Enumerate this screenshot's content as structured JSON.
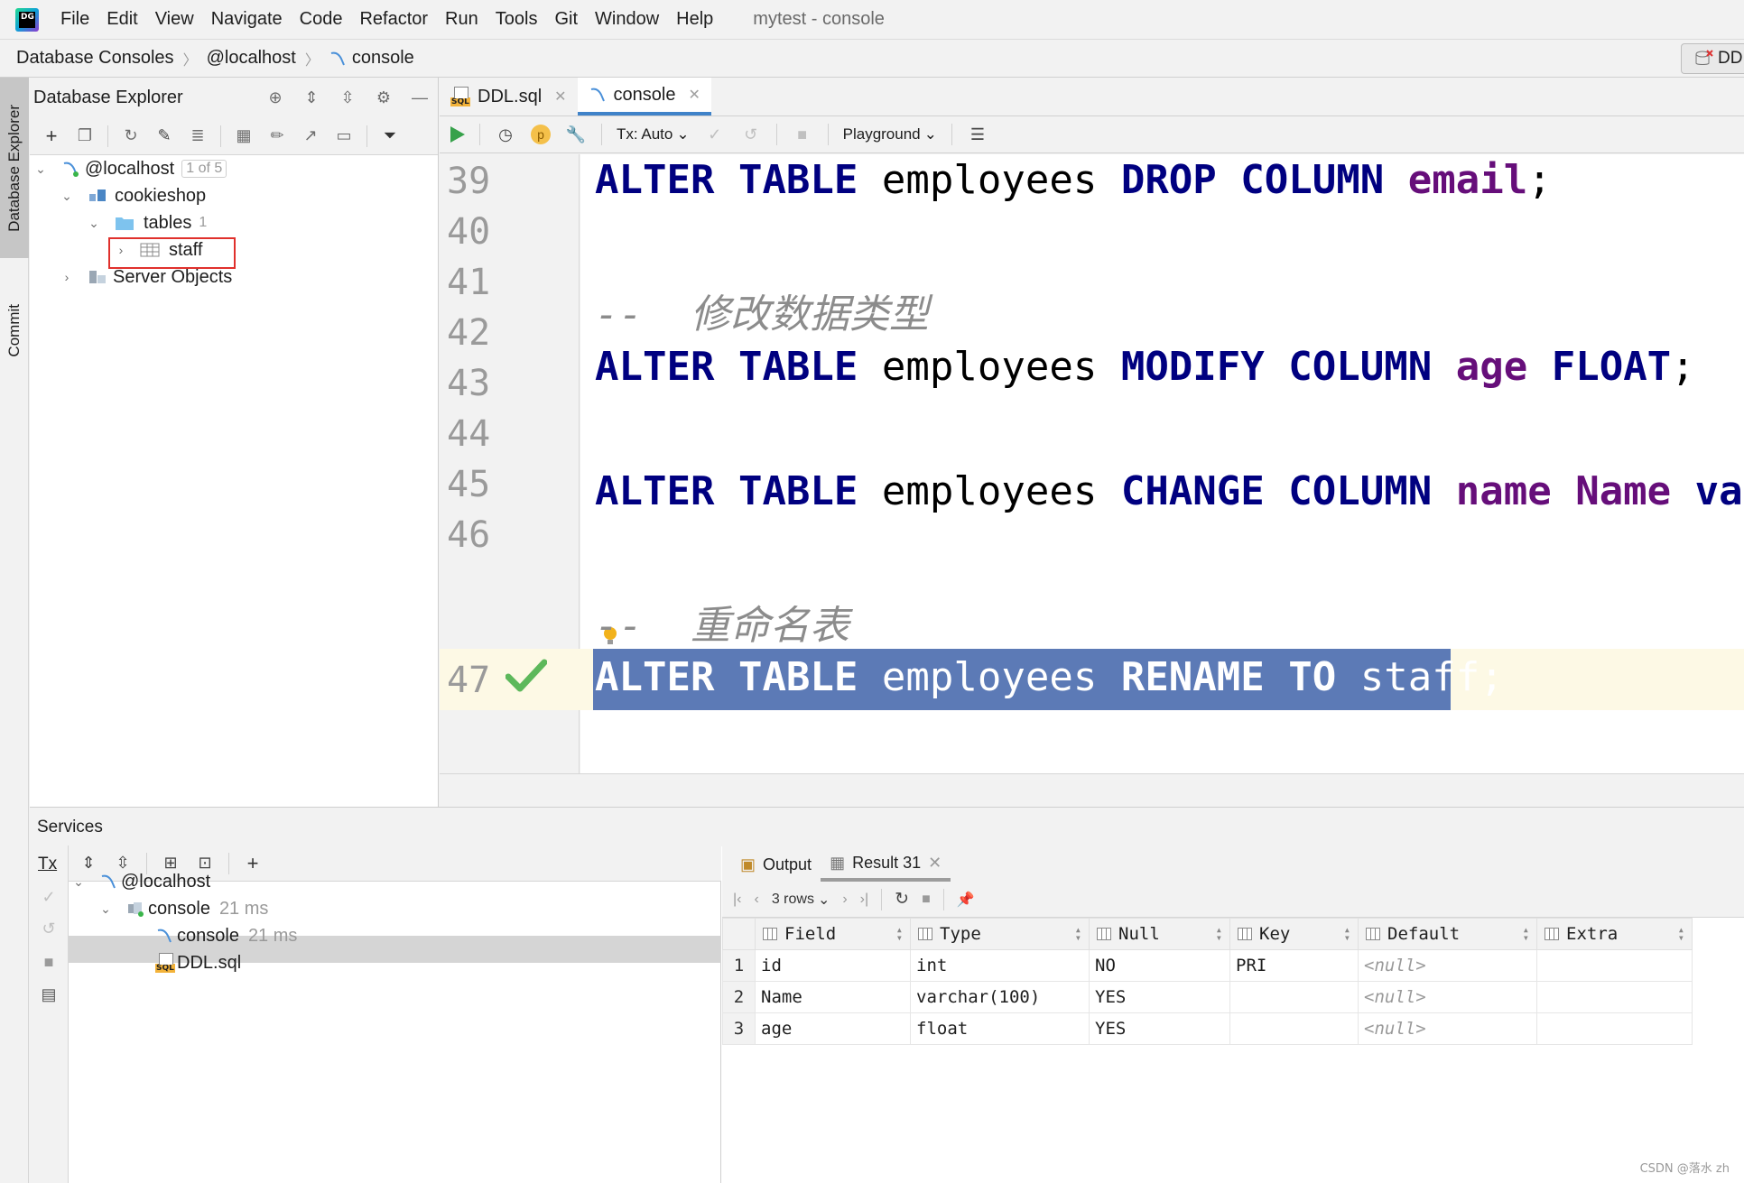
{
  "menubar": {
    "items": [
      {
        "label": "File"
      },
      {
        "label": "Edit"
      },
      {
        "label": "View"
      },
      {
        "label": "Navigate"
      },
      {
        "label": "Code"
      },
      {
        "label": "Refactor"
      },
      {
        "label": "Run"
      },
      {
        "label": "Tools"
      },
      {
        "label": "Git"
      },
      {
        "label": "Window"
      },
      {
        "label": "Help"
      }
    ],
    "window_title": "mytest - console"
  },
  "breadcrumbs": [
    "Database Consoles",
    "@localhost",
    "console"
  ],
  "dd_button": "DD",
  "left_strip": {
    "database_explorer": "Database Explorer",
    "commit": "Commit"
  },
  "db_explorer": {
    "title": "Database Explorer",
    "tree": {
      "host": "@localhost",
      "host_count": "1 of 5",
      "schema": "cookieshop",
      "tables_label": "tables",
      "tables_count": "1",
      "table": "staff",
      "server_objects": "Server Objects"
    }
  },
  "editor": {
    "tabs": [
      {
        "label": "DDL.sql"
      },
      {
        "label": "console"
      }
    ],
    "tx_mode": "Tx: Auto",
    "playground": "Playground",
    "line_numbers": [
      "39",
      "40",
      "41",
      "42",
      "43",
      "44",
      "45",
      "46",
      "47"
    ],
    "lines": {
      "l39": [
        "ALTER",
        "TABLE",
        "employees",
        "DROP",
        "COLUMN",
        "email",
        ";"
      ],
      "l41": "--  修改数据类型",
      "l42": [
        "ALTER",
        "TABLE",
        "employees",
        "MODIFY",
        "COLUMN",
        "age",
        "FLOAT",
        ";"
      ],
      "l44": [
        "ALTER",
        "TABLE",
        "employees",
        "CHANGE",
        "COLUMN",
        "name",
        "Name",
        "varch"
      ],
      "l46": "--  重命名表",
      "l47": [
        "ALTER",
        "TABLE",
        "employees",
        "RENAME",
        "TO",
        "staff",
        ";"
      ]
    }
  },
  "services": {
    "title": "Services",
    "tx_label": "Tx",
    "tree": {
      "host": "@localhost",
      "session": "console",
      "session_time": "21 ms",
      "console": "console",
      "console_time": "21 ms",
      "ddl": "DDL.sql"
    }
  },
  "results": {
    "tabs": [
      {
        "label": "Output"
      },
      {
        "label": "Result 31"
      }
    ],
    "rows_label": "3 rows",
    "columns": [
      "Field",
      "Type",
      "Null",
      "Key",
      "Default",
      "Extra"
    ],
    "rows": [
      {
        "n": "1",
        "cells": [
          "id",
          "int",
          "NO",
          "PRI",
          "<null>",
          ""
        ]
      },
      {
        "n": "2",
        "cells": [
          "Name",
          "varchar(100)",
          "YES",
          "",
          "<null>",
          ""
        ]
      },
      {
        "n": "3",
        "cells": [
          "age",
          "float",
          "YES",
          "",
          "<null>",
          ""
        ]
      }
    ]
  },
  "watermark": "CSDN @落水 zh",
  "colors": {
    "selection": "#5c7ab6",
    "keyword": "#000080",
    "column": "#660e7a",
    "run": "#36a14a",
    "highlight_box": "#e0302c"
  }
}
